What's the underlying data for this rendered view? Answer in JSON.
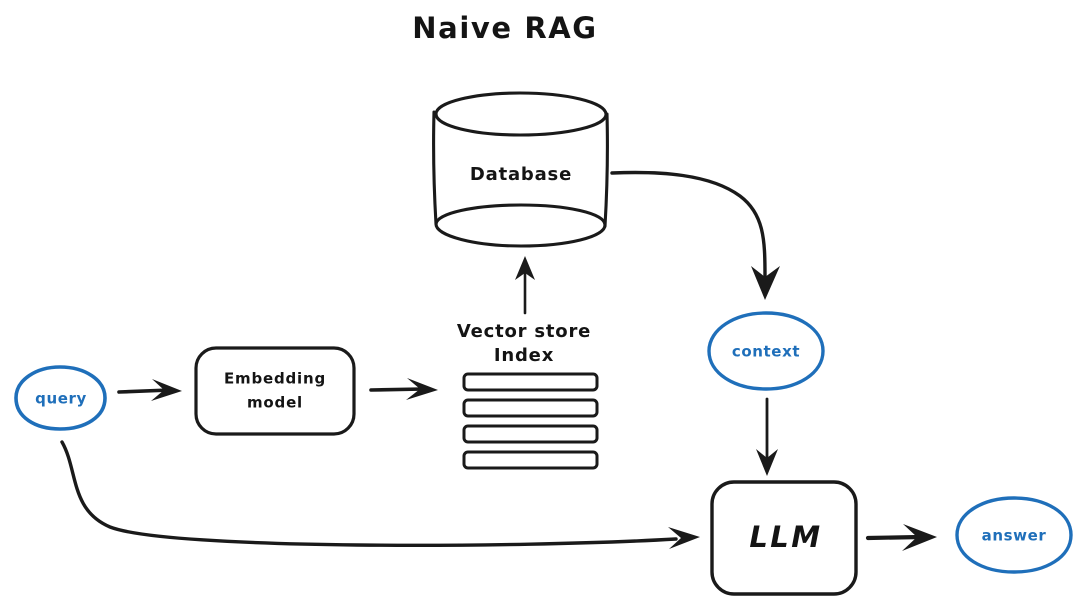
{
  "diagram": {
    "title": "Naive RAG",
    "background_color": "#ffffff",
    "ink_color": "#1a1a1a",
    "accent_color": "#1f6fba",
    "nodes": {
      "query": {
        "label": "query",
        "shape": "ellipse",
        "color": "#1f6fba"
      },
      "embedding_model": {
        "label_line1": "Embedding",
        "label_line2": "model",
        "shape": "rounded-rect",
        "color": "#1a1a1a"
      },
      "vector_store": {
        "label_line1": "Vector store",
        "label_line2": "Index",
        "shape": "stacked-bars",
        "bar_count": 4,
        "color": "#1a1a1a"
      },
      "database": {
        "label": "Database",
        "shape": "cylinder",
        "color": "#1a1a1a"
      },
      "context": {
        "label": "context",
        "shape": "ellipse",
        "color": "#1f6fba"
      },
      "llm": {
        "label": "LLM",
        "shape": "rounded-rect",
        "color": "#1a1a1a"
      },
      "answer": {
        "label": "answer",
        "shape": "ellipse",
        "color": "#1f6fba"
      }
    },
    "edges": [
      {
        "name": "query-to-embedding",
        "from": "query",
        "to": "embedding_model",
        "style": "straight-arrow"
      },
      {
        "name": "embedding-to-vector-store",
        "from": "embedding_model",
        "to": "vector_store",
        "style": "straight-arrow"
      },
      {
        "name": "vector-store-to-database",
        "from": "vector_store",
        "to": "database",
        "style": "thin-up-arrow"
      },
      {
        "name": "database-to-context",
        "from": "database",
        "to": "context",
        "style": "curved-arrow"
      },
      {
        "name": "context-to-llm",
        "from": "context",
        "to": "llm",
        "style": "thin-down-arrow"
      },
      {
        "name": "query-to-llm",
        "from": "query",
        "to": "llm",
        "style": "long-curved-arrow"
      },
      {
        "name": "llm-to-answer",
        "from": "llm",
        "to": "answer",
        "style": "straight-arrow"
      }
    ]
  }
}
